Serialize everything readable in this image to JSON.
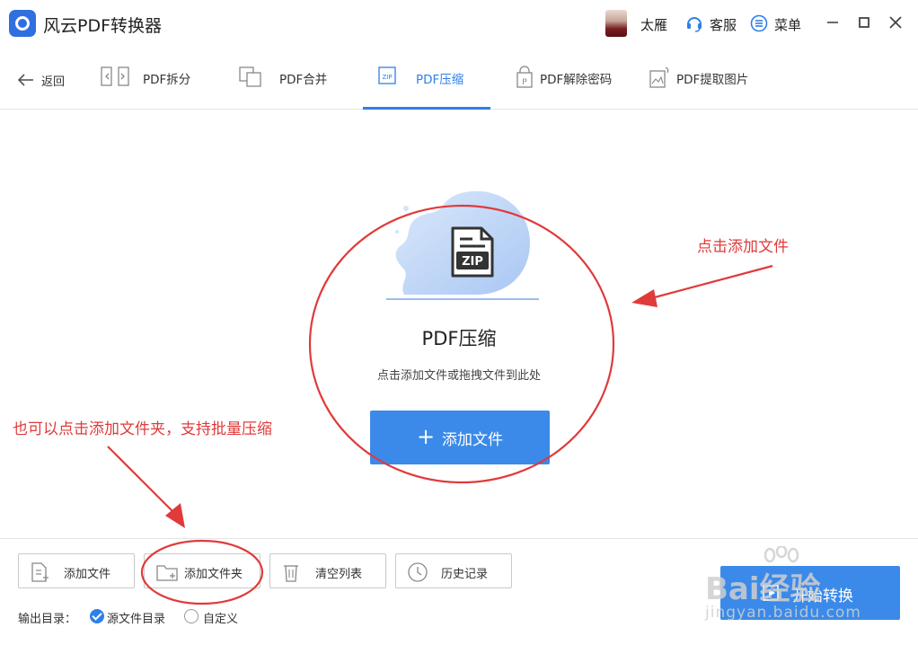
{
  "app": {
    "title": "风云PDF转换器"
  },
  "titlebar": {
    "user_name": "太雁",
    "service_label": "客服",
    "menu_label": "菜单",
    "icons": [
      "avatar",
      "headset-icon",
      "menu-icon",
      "minimize-icon",
      "maximize-icon",
      "close-icon"
    ]
  },
  "nav": {
    "back_label": "返回",
    "tabs": [
      {
        "label": "PDF拆分",
        "icon": "split-icon",
        "active": false
      },
      {
        "label": "PDF合并",
        "icon": "merge-icon",
        "active": false
      },
      {
        "label": "PDF压缩",
        "icon": "zip-icon",
        "active": true
      },
      {
        "label": "PDF解除密码",
        "icon": "pdf-unlock-icon",
        "active": false
      },
      {
        "label": "PDF提取图片",
        "icon": "image-extract-icon",
        "active": false
      }
    ]
  },
  "drop_zone": {
    "illustration_label": "ZIP",
    "title": "PDF压缩",
    "hint": "点击添加文件或拖拽文件到此处",
    "add_button_label": "添加文件"
  },
  "annotations": {
    "right": "点击添加文件",
    "left": "也可以点击添加文件夹，支持批量压缩"
  },
  "toolbar": {
    "buttons": [
      {
        "label": "添加文件",
        "icon": "add-file-icon"
      },
      {
        "label": "添加文件夹",
        "icon": "add-folder-icon"
      },
      {
        "label": "清空列表",
        "icon": "trash-icon"
      },
      {
        "label": "历史记录",
        "icon": "clock-icon"
      }
    ]
  },
  "output": {
    "label": "输出目录：",
    "options": [
      {
        "label": "源文件目录",
        "checked": true
      },
      {
        "label": "自定义",
        "checked": false
      }
    ]
  },
  "start_button": {
    "label": "开始转换"
  },
  "watermark": {
    "main": "Bai经验",
    "sub": "jingyan.baidu.com"
  },
  "colors": {
    "accent": "#3b8ae9",
    "annotation": "#e03a3a"
  }
}
